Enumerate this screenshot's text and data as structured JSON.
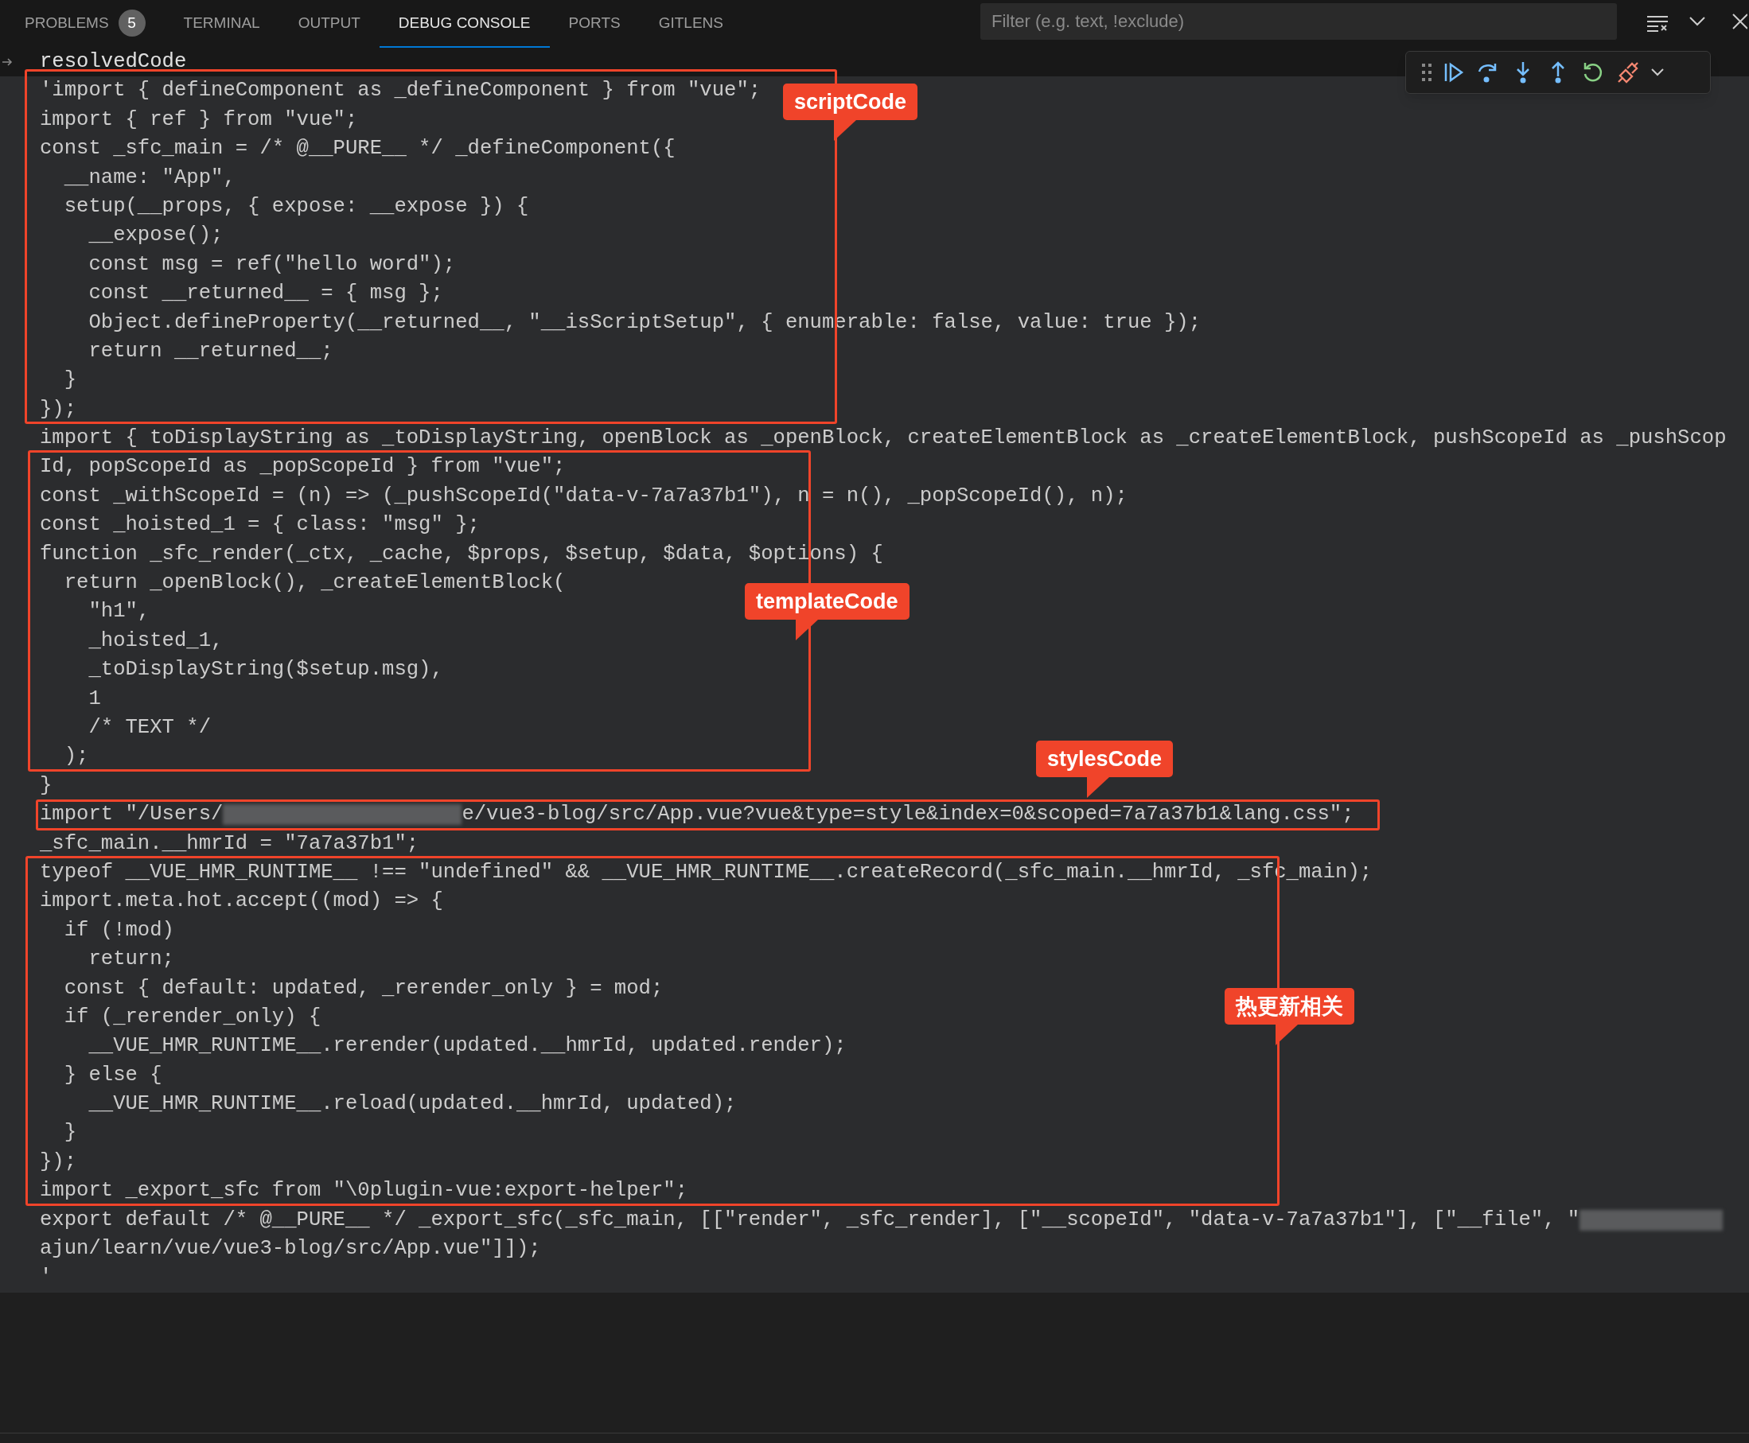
{
  "tabs": [
    {
      "label": "PROBLEMS",
      "badge": "5",
      "selected": false
    },
    {
      "label": "TERMINAL",
      "selected": false
    },
    {
      "label": "OUTPUT",
      "selected": false
    },
    {
      "label": "DEBUG CONSOLE",
      "selected": true
    },
    {
      "label": "PORTS",
      "selected": false
    },
    {
      "label": "GITLENS",
      "selected": false
    }
  ],
  "filter": {
    "placeholder": "Filter (e.g. text, !exclude)"
  },
  "console": {
    "lines": [
      {
        "kind": "expression",
        "text": "resolvedCode"
      },
      {
        "kind": "output",
        "text": "'import { defineComponent as _defineComponent } from \"vue\";"
      },
      {
        "kind": "output",
        "text": "import { ref } from \"vue\";"
      },
      {
        "kind": "output",
        "text": "const _sfc_main = /* @__PURE__ */ _defineComponent({"
      },
      {
        "kind": "output",
        "text": "  __name: \"App\","
      },
      {
        "kind": "output",
        "text": "  setup(__props, { expose: __expose }) {"
      },
      {
        "kind": "output",
        "text": "    __expose();"
      },
      {
        "kind": "output",
        "text": "    const msg = ref(\"hello word\");"
      },
      {
        "kind": "output",
        "text": "    const __returned__ = { msg };"
      },
      {
        "kind": "output",
        "text": "    Object.defineProperty(__returned__, \"__isScriptSetup\", { enumerable: false, value: true });"
      },
      {
        "kind": "output",
        "text": "    return __returned__;"
      },
      {
        "kind": "output",
        "text": "  }"
      },
      {
        "kind": "output",
        "text": "});"
      },
      {
        "kind": "output",
        "text": "import { toDisplayString as _toDisplayString, openBlock as _openBlock, createElementBlock as _createElementBlock, pushScopeId as _pushScop"
      },
      {
        "kind": "output",
        "text": "Id, popScopeId as _popScopeId } from \"vue\";"
      },
      {
        "kind": "output",
        "text": "const _withScopeId = (n) => (_pushScopeId(\"data-v-7a7a37b1\"), n = n(), _popScopeId(), n);"
      },
      {
        "kind": "output",
        "text": "const _hoisted_1 = { class: \"msg\" };"
      },
      {
        "kind": "output",
        "text": "function _sfc_render(_ctx, _cache, $props, $setup, $data, $options) {"
      },
      {
        "kind": "output",
        "text": "  return _openBlock(), _createElementBlock("
      },
      {
        "kind": "output",
        "text": "    \"h1\","
      },
      {
        "kind": "output",
        "text": "    _hoisted_1,"
      },
      {
        "kind": "output",
        "text": "    _toDisplayString($setup.msg),"
      },
      {
        "kind": "output",
        "text": "    1"
      },
      {
        "kind": "output",
        "text": "    /* TEXT */"
      },
      {
        "kind": "output",
        "text": "  );"
      },
      {
        "kind": "output",
        "text": "}"
      },
      {
        "kind": "output",
        "segments": [
          {
            "kind": "text",
            "text": "import \"/Users/"
          },
          {
            "kind": "redacted"
          },
          {
            "kind": "text",
            "text": "e/vue3-blog/src/App.vue?vue&type=style&index=0&scoped=7a7a37b1&lang.css\";"
          }
        ]
      },
      {
        "kind": "output",
        "text": "_sfc_main.__hmrId = \"7a7a37b1\";"
      },
      {
        "kind": "output",
        "text": "typeof __VUE_HMR_RUNTIME__ !== \"undefined\" && __VUE_HMR_RUNTIME__.createRecord(_sfc_main.__hmrId, _sfc_main);"
      },
      {
        "kind": "output",
        "text": "import.meta.hot.accept((mod) => {"
      },
      {
        "kind": "output",
        "text": "  if (!mod)"
      },
      {
        "kind": "output",
        "text": "    return;"
      },
      {
        "kind": "output",
        "text": "  const { default: updated, _rerender_only } = mod;"
      },
      {
        "kind": "output",
        "text": "  if (_rerender_only) {"
      },
      {
        "kind": "output",
        "text": "    __VUE_HMR_RUNTIME__.rerender(updated.__hmrId, updated.render);"
      },
      {
        "kind": "output",
        "text": "  } else {"
      },
      {
        "kind": "output",
        "text": "    __VUE_HMR_RUNTIME__.reload(updated.__hmrId, updated);"
      },
      {
        "kind": "output",
        "text": "  }"
      },
      {
        "kind": "output",
        "text": "});"
      },
      {
        "kind": "output",
        "text": "import _export_sfc from \"\\0plugin-vue:export-helper\";"
      },
      {
        "kind": "output",
        "segments": [
          {
            "kind": "text",
            "text": "export default /* @__PURE__ */ _export_sfc(_sfc_main, [[\"render\", _sfc_render], [\"__scopeId\", \"data-v-7a7a37b1\"], [\"__file\", \""
          },
          {
            "kind": "redacted"
          }
        ]
      },
      {
        "kind": "output",
        "text": "ajun/learn/vue/vue3-blog/src/App.vue\"]]);"
      },
      {
        "kind": "output",
        "text": "'"
      }
    ]
  },
  "annotations": [
    {
      "label": "scriptCode"
    },
    {
      "label": "templateCode"
    },
    {
      "label": "stylesCode"
    },
    {
      "label": "热更新相关"
    }
  ]
}
